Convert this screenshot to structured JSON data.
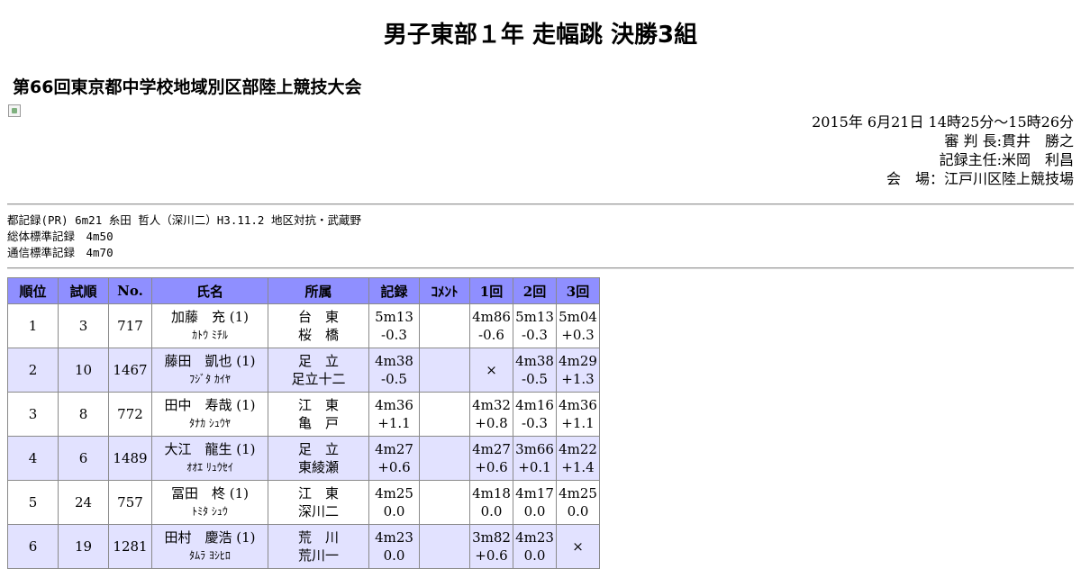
{
  "title": "男子東部１年 走幅跳 決勝3組",
  "subtitle": "第66回東京都中学校地域別区部陸上競技大会",
  "meta": {
    "datetime": "2015年 6月21日 14時25分～15時26分",
    "referee": "審 判 長:貫井　勝之",
    "recorder": "記録主任:米岡　利昌",
    "venue": "会　場：江戸川区陸上競技場"
  },
  "records": [
    "都記録(PR) 6m21 糸田 哲人（深川二）H3.11.2 地区対抗・武蔵野",
    "総体標準記録　4m50",
    "通信標準記録　4m70"
  ],
  "table": {
    "headers": [
      "順位",
      "試順",
      "No.",
      "氏名",
      "所属",
      "記録",
      "ｺﾒﾝﾄ",
      "1回",
      "2回",
      "3回"
    ],
    "rows": [
      {
        "rank": "1",
        "order": "3",
        "no": "717",
        "name": "加藤　充 (1)",
        "kana": "ｶﾄｳ ﾐﾁﾙ",
        "aff1": "台　東",
        "aff2": "桜　橋",
        "mark": "5m13",
        "wind": "-0.3",
        "comment": "",
        "t1": "4m86",
        "w1": "-0.6",
        "t2": "5m13",
        "w2": "-0.3",
        "t3": "5m04",
        "w3": "+0.3"
      },
      {
        "rank": "2",
        "order": "10",
        "no": "1467",
        "name": "藤田　凱也 (1)",
        "kana": "ﾌｼﾞﾀ ｶｲﾔ",
        "aff1": "足　立",
        "aff2": "足立十二",
        "mark": "4m38",
        "wind": "-0.5",
        "comment": "",
        "t1": "×",
        "w1": "",
        "t2": "4m38",
        "w2": "-0.5",
        "t3": "4m29",
        "w3": "+1.3"
      },
      {
        "rank": "3",
        "order": "8",
        "no": "772",
        "name": "田中　寿哉 (1)",
        "kana": "ﾀﾅｶ ｼｭｳﾔ",
        "aff1": "江　東",
        "aff2": "亀　戸",
        "mark": "4m36",
        "wind": "+1.1",
        "comment": "",
        "t1": "4m32",
        "w1": "+0.8",
        "t2": "4m16",
        "w2": "-0.3",
        "t3": "4m36",
        "w3": "+1.1"
      },
      {
        "rank": "4",
        "order": "6",
        "no": "1489",
        "name": "大江　龍生 (1)",
        "kana": "ｵｵｴ ﾘｭｳｾｲ",
        "aff1": "足　立",
        "aff2": "東綾瀬",
        "mark": "4m27",
        "wind": "+0.6",
        "comment": "",
        "t1": "4m27",
        "w1": "+0.6",
        "t2": "3m66",
        "w2": "+0.1",
        "t3": "4m22",
        "w3": "+1.4"
      },
      {
        "rank": "5",
        "order": "24",
        "no": "757",
        "name": "冨田　柊 (1)",
        "kana": "ﾄﾐﾀ ｼｭｳ",
        "aff1": "江　東",
        "aff2": "深川二",
        "mark": "4m25",
        "wind": "0.0",
        "comment": "",
        "t1": "4m18",
        "w1": "0.0",
        "t2": "4m17",
        "w2": "0.0",
        "t3": "4m25",
        "w3": "0.0"
      },
      {
        "rank": "6",
        "order": "19",
        "no": "1281",
        "name": "田村　慶浩 (1)",
        "kana": "ﾀﾑﾗ ﾖｼﾋﾛ",
        "aff1": "荒　川",
        "aff2": "荒川一",
        "mark": "4m23",
        "wind": "0.0",
        "comment": "",
        "t1": "3m82",
        "w1": "+0.6",
        "t2": "4m23",
        "w2": "0.0",
        "t3": "×",
        "w3": ""
      }
    ]
  }
}
